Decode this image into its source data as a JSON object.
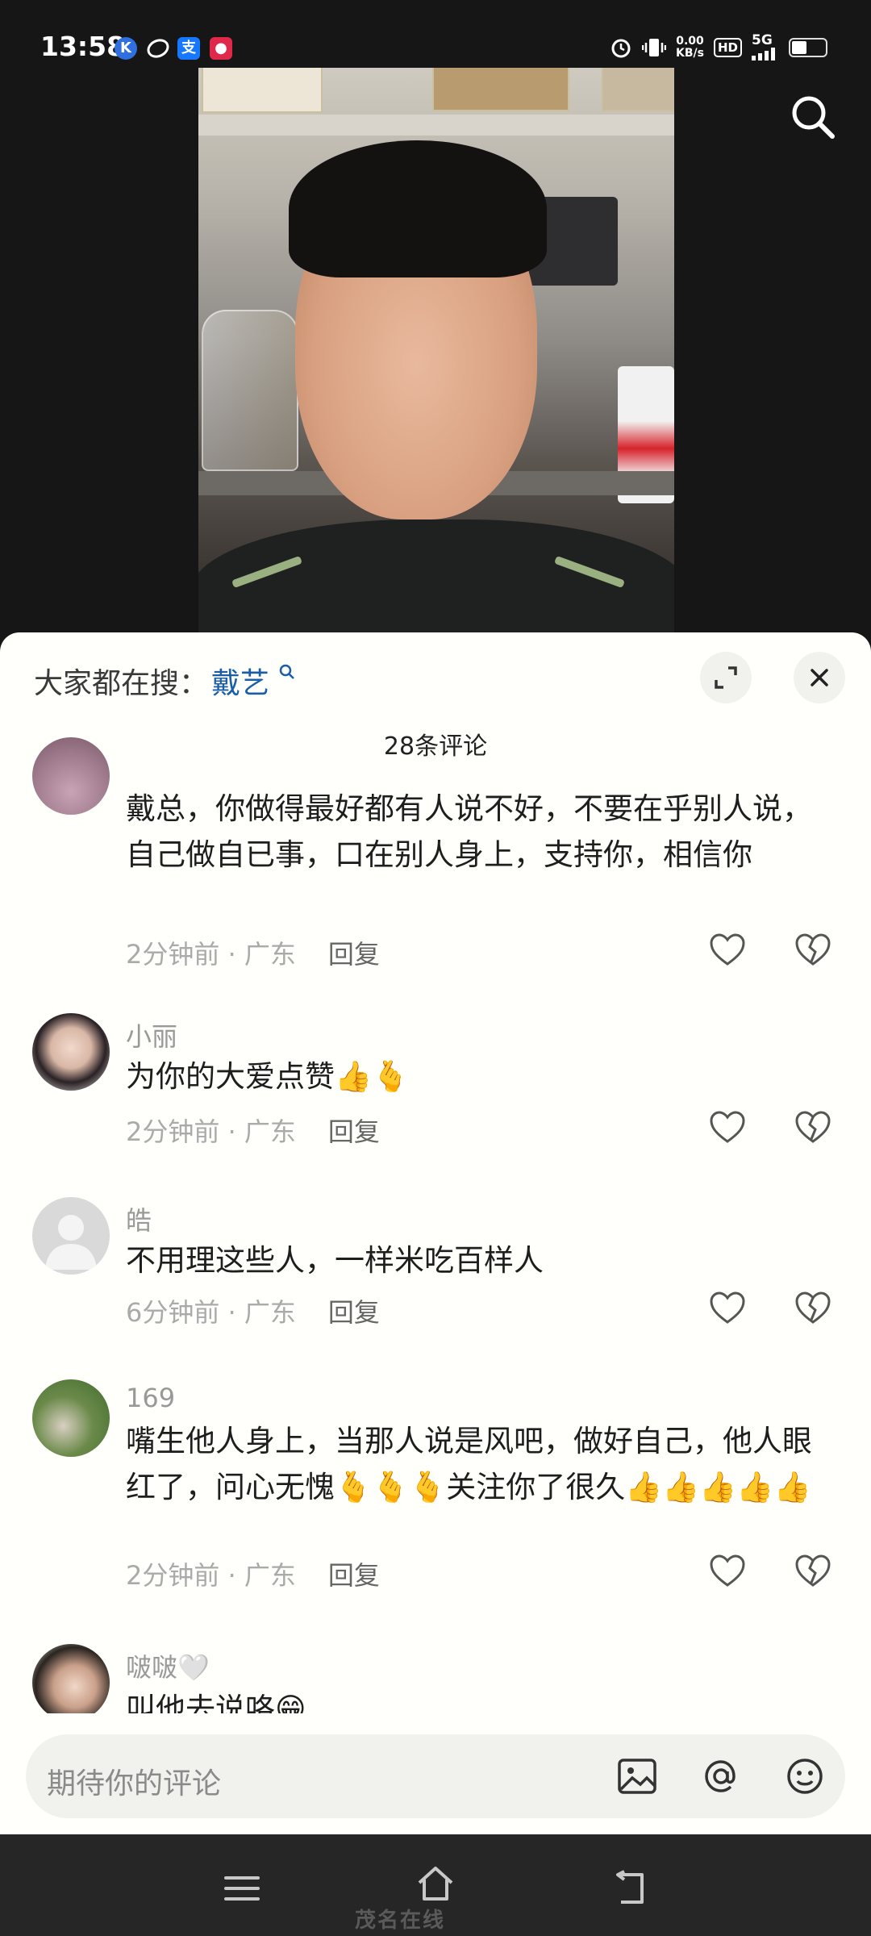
{
  "status_bar": {
    "time": "13:58",
    "net_speed_value": "0.00",
    "net_speed_unit": "KB/s",
    "hd_badge": "HD",
    "network": "5G"
  },
  "sheet": {
    "hot_search_label": "大家都在搜：",
    "hot_search_term": "戴艺",
    "comment_count": "28条评论"
  },
  "comments": [
    {
      "username": "",
      "text": "戴总，你做得最好都有人说不好，不要在乎别人说，自己做自已事，口在别人身上，支持你，相信你",
      "time": "2分钟前 · 广东",
      "reply": "回复"
    },
    {
      "username": "小丽",
      "text": "为你的大爱点赞👍🫰",
      "time": "2分钟前 · 广东",
      "reply": "回复"
    },
    {
      "username": "皓",
      "text": "不用理这些人，一样米吃百样人",
      "time": "6分钟前 · 广东",
      "reply": "回复"
    },
    {
      "username": "169",
      "text": "嘴生他人身上，当那人说是风吧，做好自己，他人眼红了，问心无愧🫰🫰🫰关注你了很久👍👍👍👍👍",
      "time": "2分钟前 · 广东",
      "reply": "回复"
    },
    {
      "username": "啵啵🤍",
      "text": "叫他去说咯😁",
      "time": "",
      "reply": ""
    }
  ],
  "input": {
    "placeholder": "期待你的评论"
  },
  "watermark": "茂名在线"
}
